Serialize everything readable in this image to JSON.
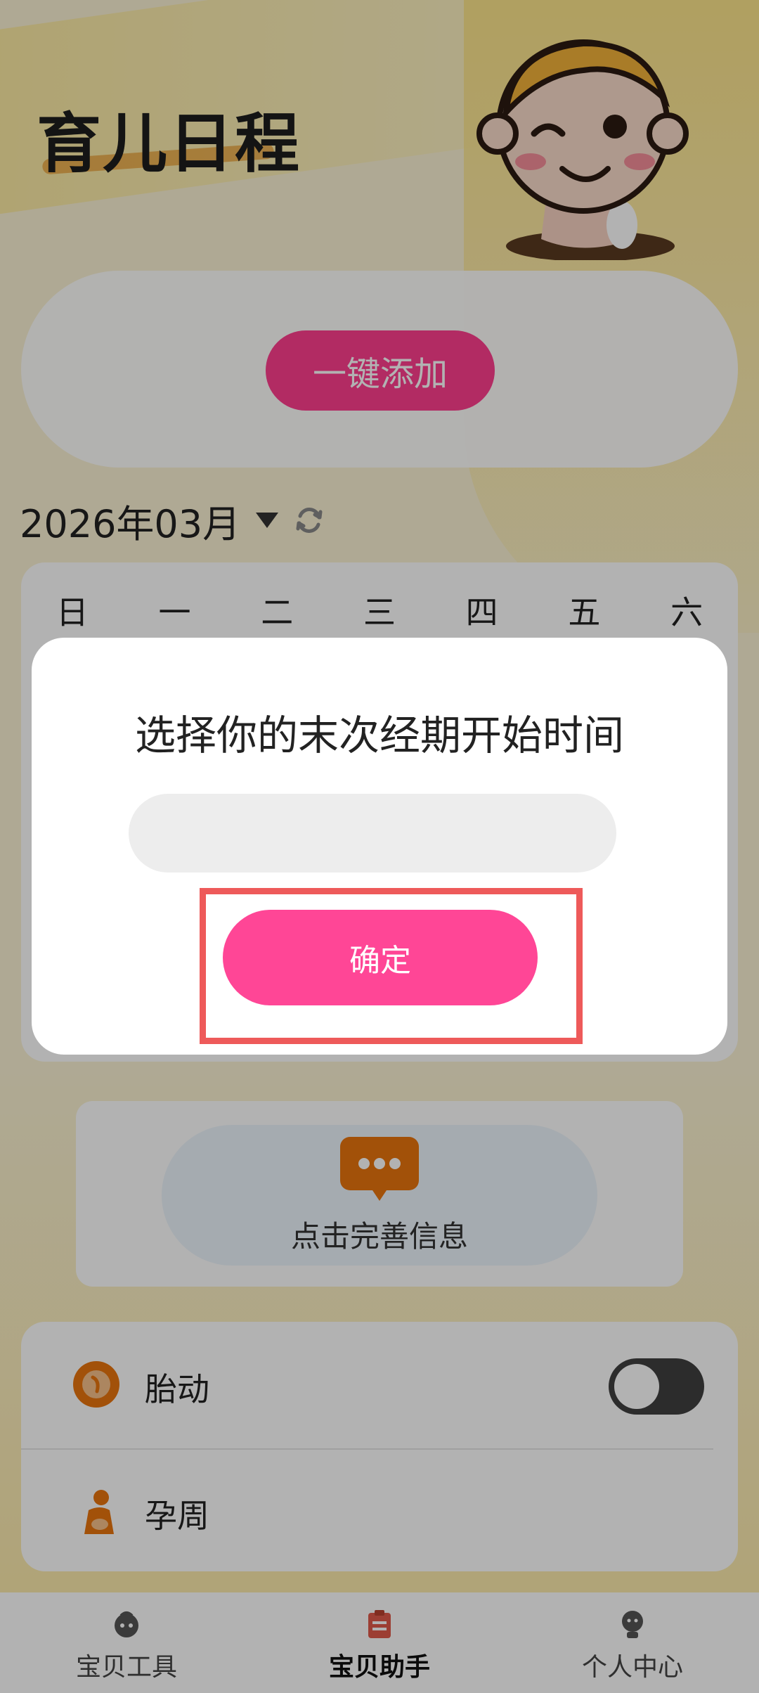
{
  "header": {
    "title": "育儿日程"
  },
  "quick_add": {
    "label": "一键添加"
  },
  "calendar": {
    "month": "2026年03月",
    "weekdays": [
      "日",
      "一",
      "二",
      "三",
      "四",
      "五",
      "六"
    ]
  },
  "info_card": {
    "text": "点击完善信息"
  },
  "settings": {
    "fetal_movement": {
      "label": "胎动",
      "enabled": false
    },
    "pregnancy_week": {
      "label": "孕周"
    }
  },
  "bottom_nav": {
    "items": [
      {
        "label": "宝贝工具",
        "icon": "baby-face-icon",
        "active": false
      },
      {
        "label": "宝贝助手",
        "icon": "clipboard-icon",
        "active": true
      },
      {
        "label": "个人中心",
        "icon": "person-icon",
        "active": false
      }
    ]
  },
  "dialog": {
    "title": "选择你的末次经期开始时间",
    "date_value": "",
    "confirm_label": "确定"
  },
  "colors": {
    "accent": "#FF4696",
    "highlight": "#EE5A5A",
    "icon_orange": "#E8740E",
    "background": "#FBF3D5"
  }
}
